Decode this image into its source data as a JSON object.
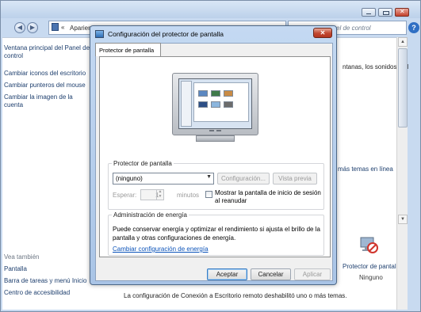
{
  "background_window": {
    "address": "Aparien",
    "address_prefix": "«",
    "search_placeholder": "el de control",
    "sidebar": {
      "home": "Ventana principal del Panel de control",
      "links": [
        "Cambiar iconos del escritorio",
        "Cambiar punteros del mouse",
        "Cambiar la imagen de la cuenta"
      ],
      "see_also_title": "Vea también",
      "see_also_links": [
        "Pantalla",
        "Barra de tareas y menú Inicio",
        "Centro de accesibilidad"
      ]
    },
    "right_text": "ntanas, los sonidos y el",
    "more_themes": "más temas en línea",
    "screensaver_label": "Protector de pantalla",
    "screensaver_value": "Ninguno",
    "info": "La configuración de Conexión a Escritorio remoto deshabilitó uno o más temas."
  },
  "dialog": {
    "title": "Configuración del protector de pantalla",
    "close_label": "✕",
    "tab": "Protector de pantalla",
    "screensaver_group": {
      "title": "Protector de pantalla",
      "selected": "(ninguno)",
      "settings_button": "Configuración...",
      "preview_button": "Vista previa",
      "wait_label": "Esperar:",
      "wait_value": "1",
      "minutes_label": "minutos",
      "resume_checkbox_label": "Mostrar la pantalla de inicio de sesión al reanudar",
      "resume_checked": false
    },
    "power_group": {
      "title": "Administración de energía",
      "description": "Puede conservar energía y optimizar el rendimiento si ajusta el brillo de la pantalla y otras configuraciones de energía.",
      "link": "Cambiar configuración de energía"
    },
    "buttons": {
      "ok": "Aceptar",
      "cancel": "Cancelar",
      "apply": "Aplicar"
    }
  },
  "colors": {
    "dialog_frame": "#a9c4e6",
    "close_red": "#c1462f",
    "link_blue": "#0b53b9"
  }
}
